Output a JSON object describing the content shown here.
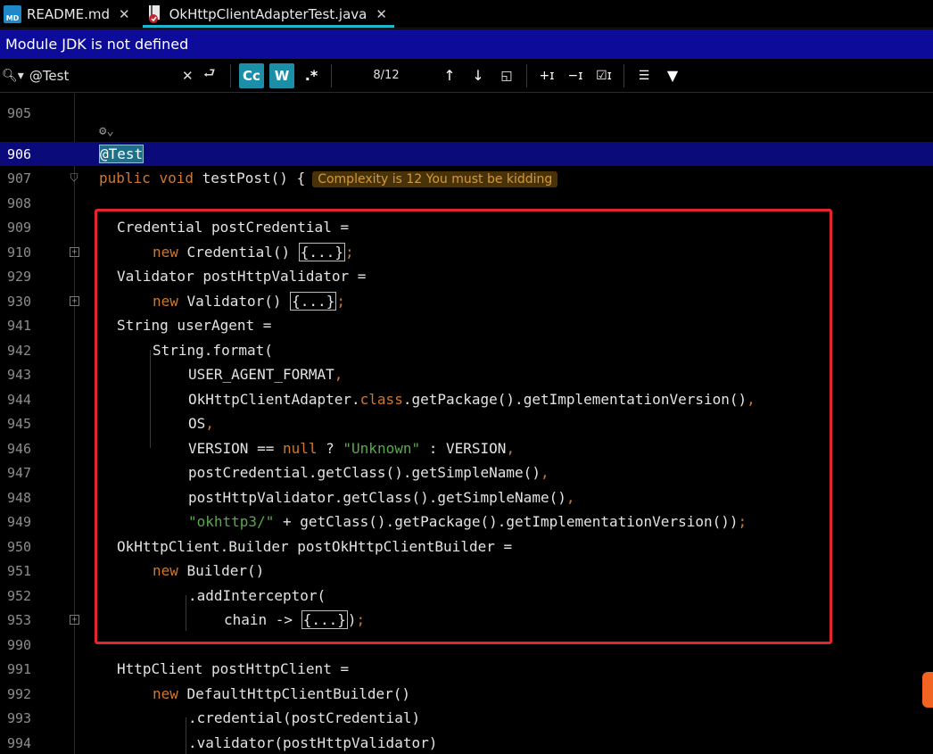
{
  "tabs": [
    {
      "label": "README.md",
      "icon": "markdown-file-icon",
      "icon_text": "MD",
      "active": false
    },
    {
      "label": "OkHttpClientAdapterTest.java",
      "icon": "java-test-file-icon",
      "active": true
    }
  ],
  "banner": {
    "text": "Module JDK is not defined"
  },
  "search": {
    "query": "@Test",
    "match_count": "8/12",
    "toggle_case": "Cc",
    "toggle_words": "W",
    "toggle_regex": ".*"
  },
  "gutter_line": "905",
  "editor": {
    "current_line": "906",
    "inlay_hint": "Complexity is 12 You must be kidding",
    "lines": [
      {
        "n": "906"
      },
      {
        "n": "907"
      },
      {
        "n": "908"
      },
      {
        "n": "909"
      },
      {
        "n": "910"
      },
      {
        "n": "929"
      },
      {
        "n": "930"
      },
      {
        "n": "941"
      },
      {
        "n": "942"
      },
      {
        "n": "943"
      },
      {
        "n": "944"
      },
      {
        "n": "945"
      },
      {
        "n": "946"
      },
      {
        "n": "947"
      },
      {
        "n": "948"
      },
      {
        "n": "949"
      },
      {
        "n": "950"
      },
      {
        "n": "951"
      },
      {
        "n": "952"
      },
      {
        "n": "953"
      },
      {
        "n": "990"
      },
      {
        "n": "991"
      },
      {
        "n": "992"
      },
      {
        "n": "993"
      },
      {
        "n": "994"
      }
    ],
    "code": {
      "l906": "@Test",
      "l907_kw1": "public",
      "l907_kw2": "void",
      "l907_rest": "testPost() {",
      "l909": "Credential postCredential =",
      "l910_kw": "new",
      "l910_rest": "Credential()",
      "fold_placeholder": "{...}",
      "l929": "Validator postHttpValidator =",
      "l930_rest": "Validator()",
      "l941": "String userAgent =",
      "l942": "String.format(",
      "l943": "USER_AGENT_FORMAT",
      "l944_a": "OkHttpClientAdapter.",
      "l944_kw": "class",
      "l944_b": ".getPackage().getImplementationVersion()",
      "l945": "OS",
      "l946_a": "VERSION == ",
      "l946_kw": "null",
      "l946_b": " ? ",
      "l946_str": "\"Unknown\"",
      "l946_c": " : VERSION",
      "l947": "postCredential.getClass().getSimpleName()",
      "l948": "postHttpValidator.getClass().getSimpleName()",
      "l949_str": "\"okhttp3/\"",
      "l949_rest": " + getClass().getPackage().getImplementationVersion())",
      "l950": "OkHttpClient.Builder postOkHttpClientBuilder =",
      "l951_rest": "Builder()",
      "l952": ".addInterceptor(",
      "l953": "chain -> ",
      "l953_end": ")",
      "l990": "",
      "l991": "HttpClient postHttpClient =",
      "l992_rest": "DefaultHttpClientBuilder()",
      "l993": ".credential(postCredential)",
      "l994": ".validator(postHttpValidator)"
    }
  },
  "colors": {
    "keyword": "#cc7832",
    "string": "#59a84b",
    "banner": "#0d0b9a",
    "highlight_box": "#e3262b",
    "accent": "#1fb7cf"
  }
}
